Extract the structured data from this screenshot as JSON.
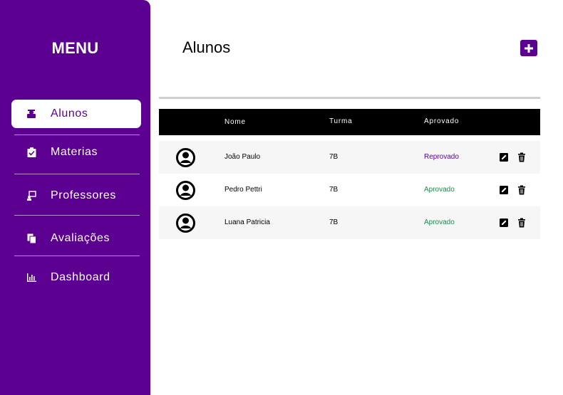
{
  "sidebar": {
    "title": "MENU",
    "items": [
      {
        "label": "Alunos",
        "icon": "student-icon",
        "active": true
      },
      {
        "label": "Materias",
        "icon": "clipboard-check-icon",
        "active": false
      },
      {
        "label": "Professores",
        "icon": "teacher-board-icon",
        "active": false
      },
      {
        "label": "Avaliações",
        "icon": "documents-icon",
        "active": false
      },
      {
        "label": "Dashboard",
        "icon": "bar-chart-icon",
        "active": false
      }
    ]
  },
  "main": {
    "title": "Alunos",
    "add_icon": "plus-square-icon",
    "table": {
      "headers": [
        "",
        "Nome",
        "Turma",
        "Aprovado",
        ""
      ],
      "rows": [
        {
          "name": "João Paulo",
          "turma": "7B",
          "status": "Reprovado"
        },
        {
          "name": "Pedro Pettri",
          "turma": "7B",
          "status": "Aprovado"
        },
        {
          "name": "Luana Patricia",
          "turma": "7B",
          "status": "Aprovado"
        }
      ]
    }
  },
  "colors": {
    "brand": "#5b0090",
    "approved": "#1f8a4c",
    "failed": "#5b0090",
    "header_bg": "#000000"
  }
}
